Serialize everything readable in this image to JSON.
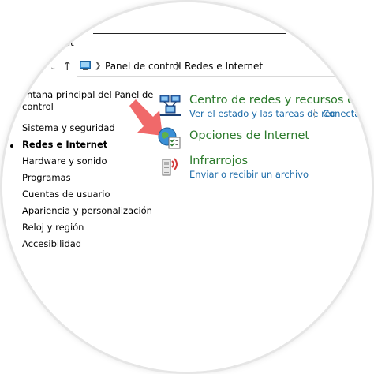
{
  "window": {
    "title_fragment": "net"
  },
  "address_bar": {
    "crumbs": [
      "Panel de control",
      "Redes e Internet"
    ]
  },
  "sidebar": {
    "home_link_line1": "ntana principal del Panel de",
    "home_link_line2": "control",
    "items": [
      {
        "label": "Sistema y seguridad",
        "active": false
      },
      {
        "label": "Redes e Internet",
        "active": true
      },
      {
        "label": "Hardware y sonido",
        "active": false
      },
      {
        "label": "Programas",
        "active": false
      },
      {
        "label": "Cuentas de usuario",
        "active": false
      },
      {
        "label": "Apariencia y personalización",
        "active": false
      },
      {
        "label": "Reloj y región",
        "active": false
      },
      {
        "label": "Accesibilidad",
        "active": false
      }
    ]
  },
  "categories": [
    {
      "title": "Centro de redes y recursos comp",
      "icon": "network-center-icon",
      "links": [
        "Ver el estado y las tareas de red",
        "Conecta"
      ]
    },
    {
      "title": "Opciones de Internet",
      "icon": "internet-options-icon",
      "links": []
    },
    {
      "title": "Infrarrojos",
      "icon": "infrared-icon",
      "links": [
        "Enviar o recibir un archivo"
      ]
    }
  ],
  "colors": {
    "category_title": "#2b7a2b",
    "link": "#1a6aa8",
    "pointer_arrow": "#f0696a"
  }
}
